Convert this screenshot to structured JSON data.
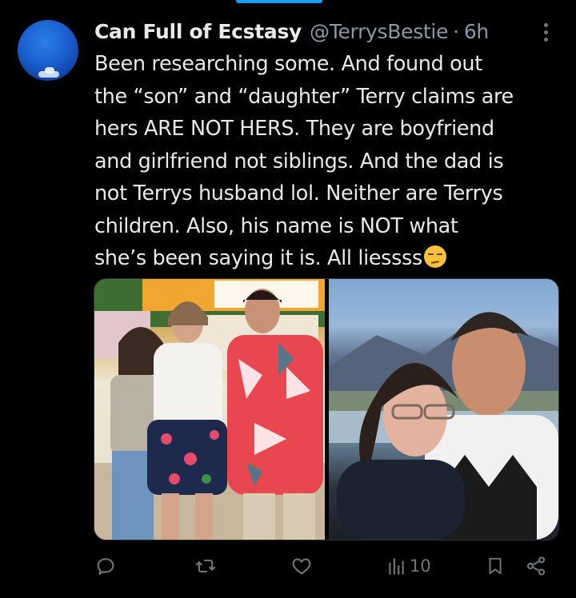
{
  "tweet": {
    "display_name": "Can Full of Ecstasy",
    "handle": "@TerrysBestie",
    "separator": "·",
    "time": "6h",
    "text_lines": [
      "Been researching some. And found out",
      "the “son” and “daughter” Terry claims are",
      "hers ARE NOT HERS. They are boyfriend",
      "and girlfriend not siblings. And the dad is",
      "not Terrys husband lol. Neither are Terrys",
      "children. Also, his name is NOT what",
      "she’s been saying it is. All liessss"
    ],
    "emoji": "unamused-face",
    "media": [
      {
        "description_icon": "photo"
      },
      {
        "description_icon": "photo"
      }
    ]
  },
  "actions": {
    "reply_icon": "reply-icon",
    "retweet_icon": "retweet-icon",
    "like_icon": "heart-icon",
    "views_icon": "views-icon",
    "views_count": "10",
    "bookmark_icon": "bookmark-icon",
    "share_icon": "share-icon"
  },
  "colors": {
    "background": "#000000",
    "text": "#e7e9ea",
    "muted": "#71767b",
    "accent": "#1d9bf0"
  }
}
